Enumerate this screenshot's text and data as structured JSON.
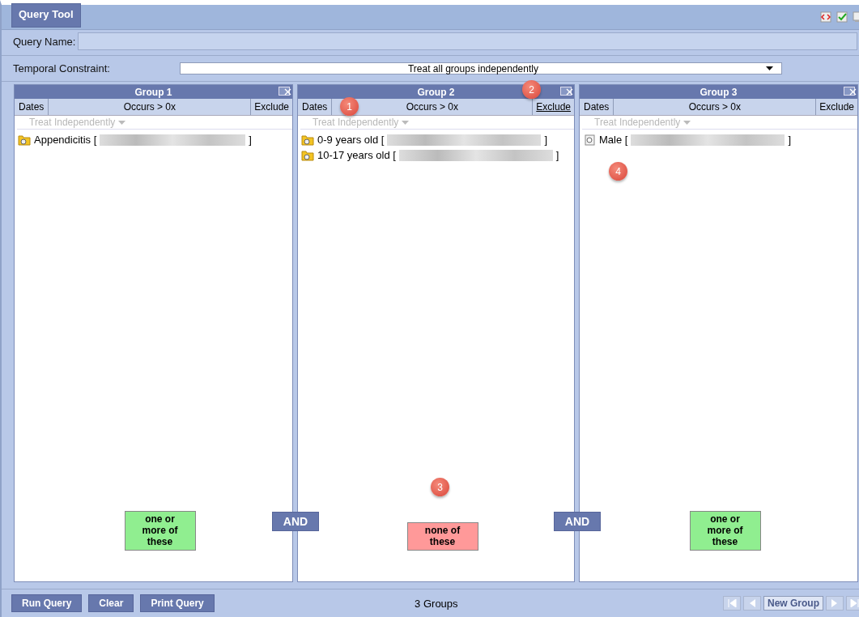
{
  "tab": {
    "label": "Query Tool",
    "selected": true
  },
  "query_name": {
    "label": "Query Name:"
  },
  "temporal_constraint": {
    "label": "Temporal Constraint:",
    "value": "Treat all groups independently"
  },
  "groups": [
    {
      "title": "Group 1",
      "dates": "Dates",
      "occurs": "Occurs > 0x",
      "exclude_label": "Exclude",
      "exclude": false,
      "timing": "Treat Independently",
      "items": [
        {
          "kind": "folder",
          "label": "Appendicitis [",
          "close": "]"
        }
      ],
      "logic": "one or more of these"
    },
    {
      "title": "Group 2",
      "dates": "Dates",
      "occurs": "Occurs > 0x",
      "exclude_label": "Exclude",
      "exclude": true,
      "timing": "Treat Independently",
      "items": [
        {
          "kind": "folder",
          "label": "0-9 years old [",
          "close": "]"
        },
        {
          "kind": "folder",
          "label": "10-17 years old [",
          "close": "]"
        }
      ],
      "logic": "none of these"
    },
    {
      "title": "Group 3",
      "dates": "Dates",
      "occurs": "Occurs > 0x",
      "exclude_label": "Exclude",
      "exclude": false,
      "timing": "Treat Independently",
      "items": [
        {
          "kind": "leaf",
          "label": "Male [",
          "close": "]"
        }
      ],
      "logic": "one or more of these"
    }
  ],
  "connectors": [
    "AND",
    "AND"
  ],
  "callouts": [
    "1",
    "2",
    "3",
    "4"
  ],
  "footer": {
    "buttons": [
      "Run Query",
      "Clear",
      "Print Query"
    ],
    "status": "3 Groups",
    "new_group": "New Group"
  }
}
